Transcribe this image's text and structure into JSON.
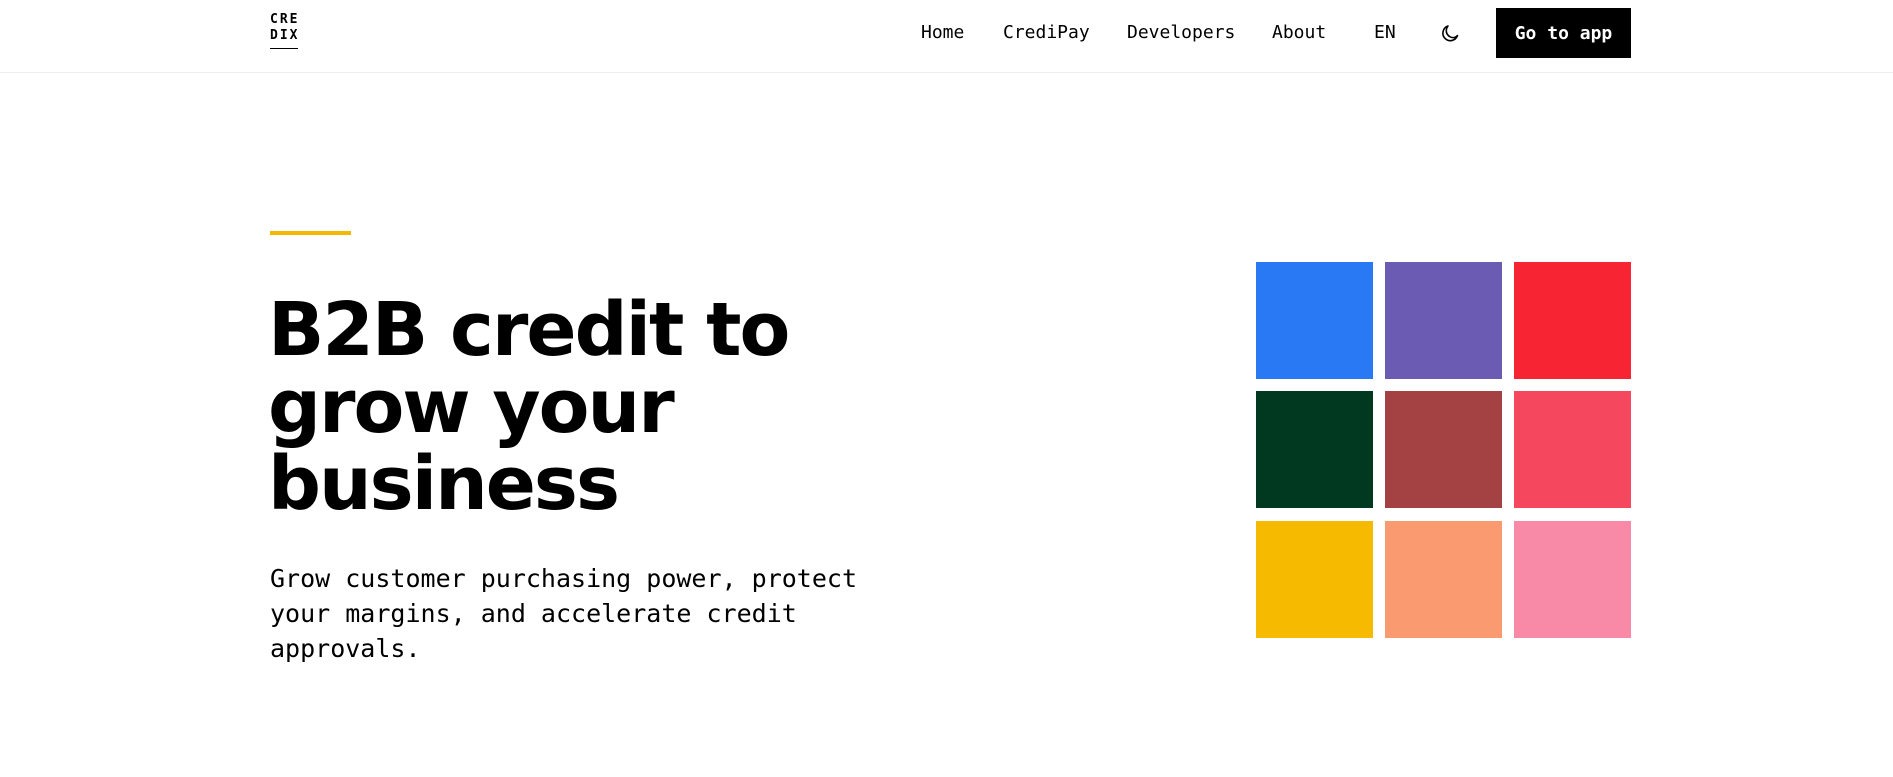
{
  "logo": {
    "line1": "CRE",
    "line2": "DIX"
  },
  "nav": {
    "items": [
      "Home",
      "CrediPay",
      "Developers",
      "About"
    ],
    "language": "EN",
    "theme_icon": "moon-icon",
    "cta_label": "Go to app"
  },
  "hero": {
    "headline_line1": "B2B credit to",
    "headline_line2": "grow your",
    "headline_line3": "business",
    "subhead_line1": "Grow customer purchasing power, protect",
    "subhead_line2": "your margins, and accelerate credit",
    "subhead_line3": "approvals.",
    "accent_color": "#f5b800"
  },
  "tiles": {
    "colors": [
      "#2979f5",
      "#6c5bb3",
      "#f72534",
      "#003920",
      "#a34143",
      "#f5485e",
      "#f6bb00",
      "#f99a71",
      "#f889a7"
    ]
  }
}
